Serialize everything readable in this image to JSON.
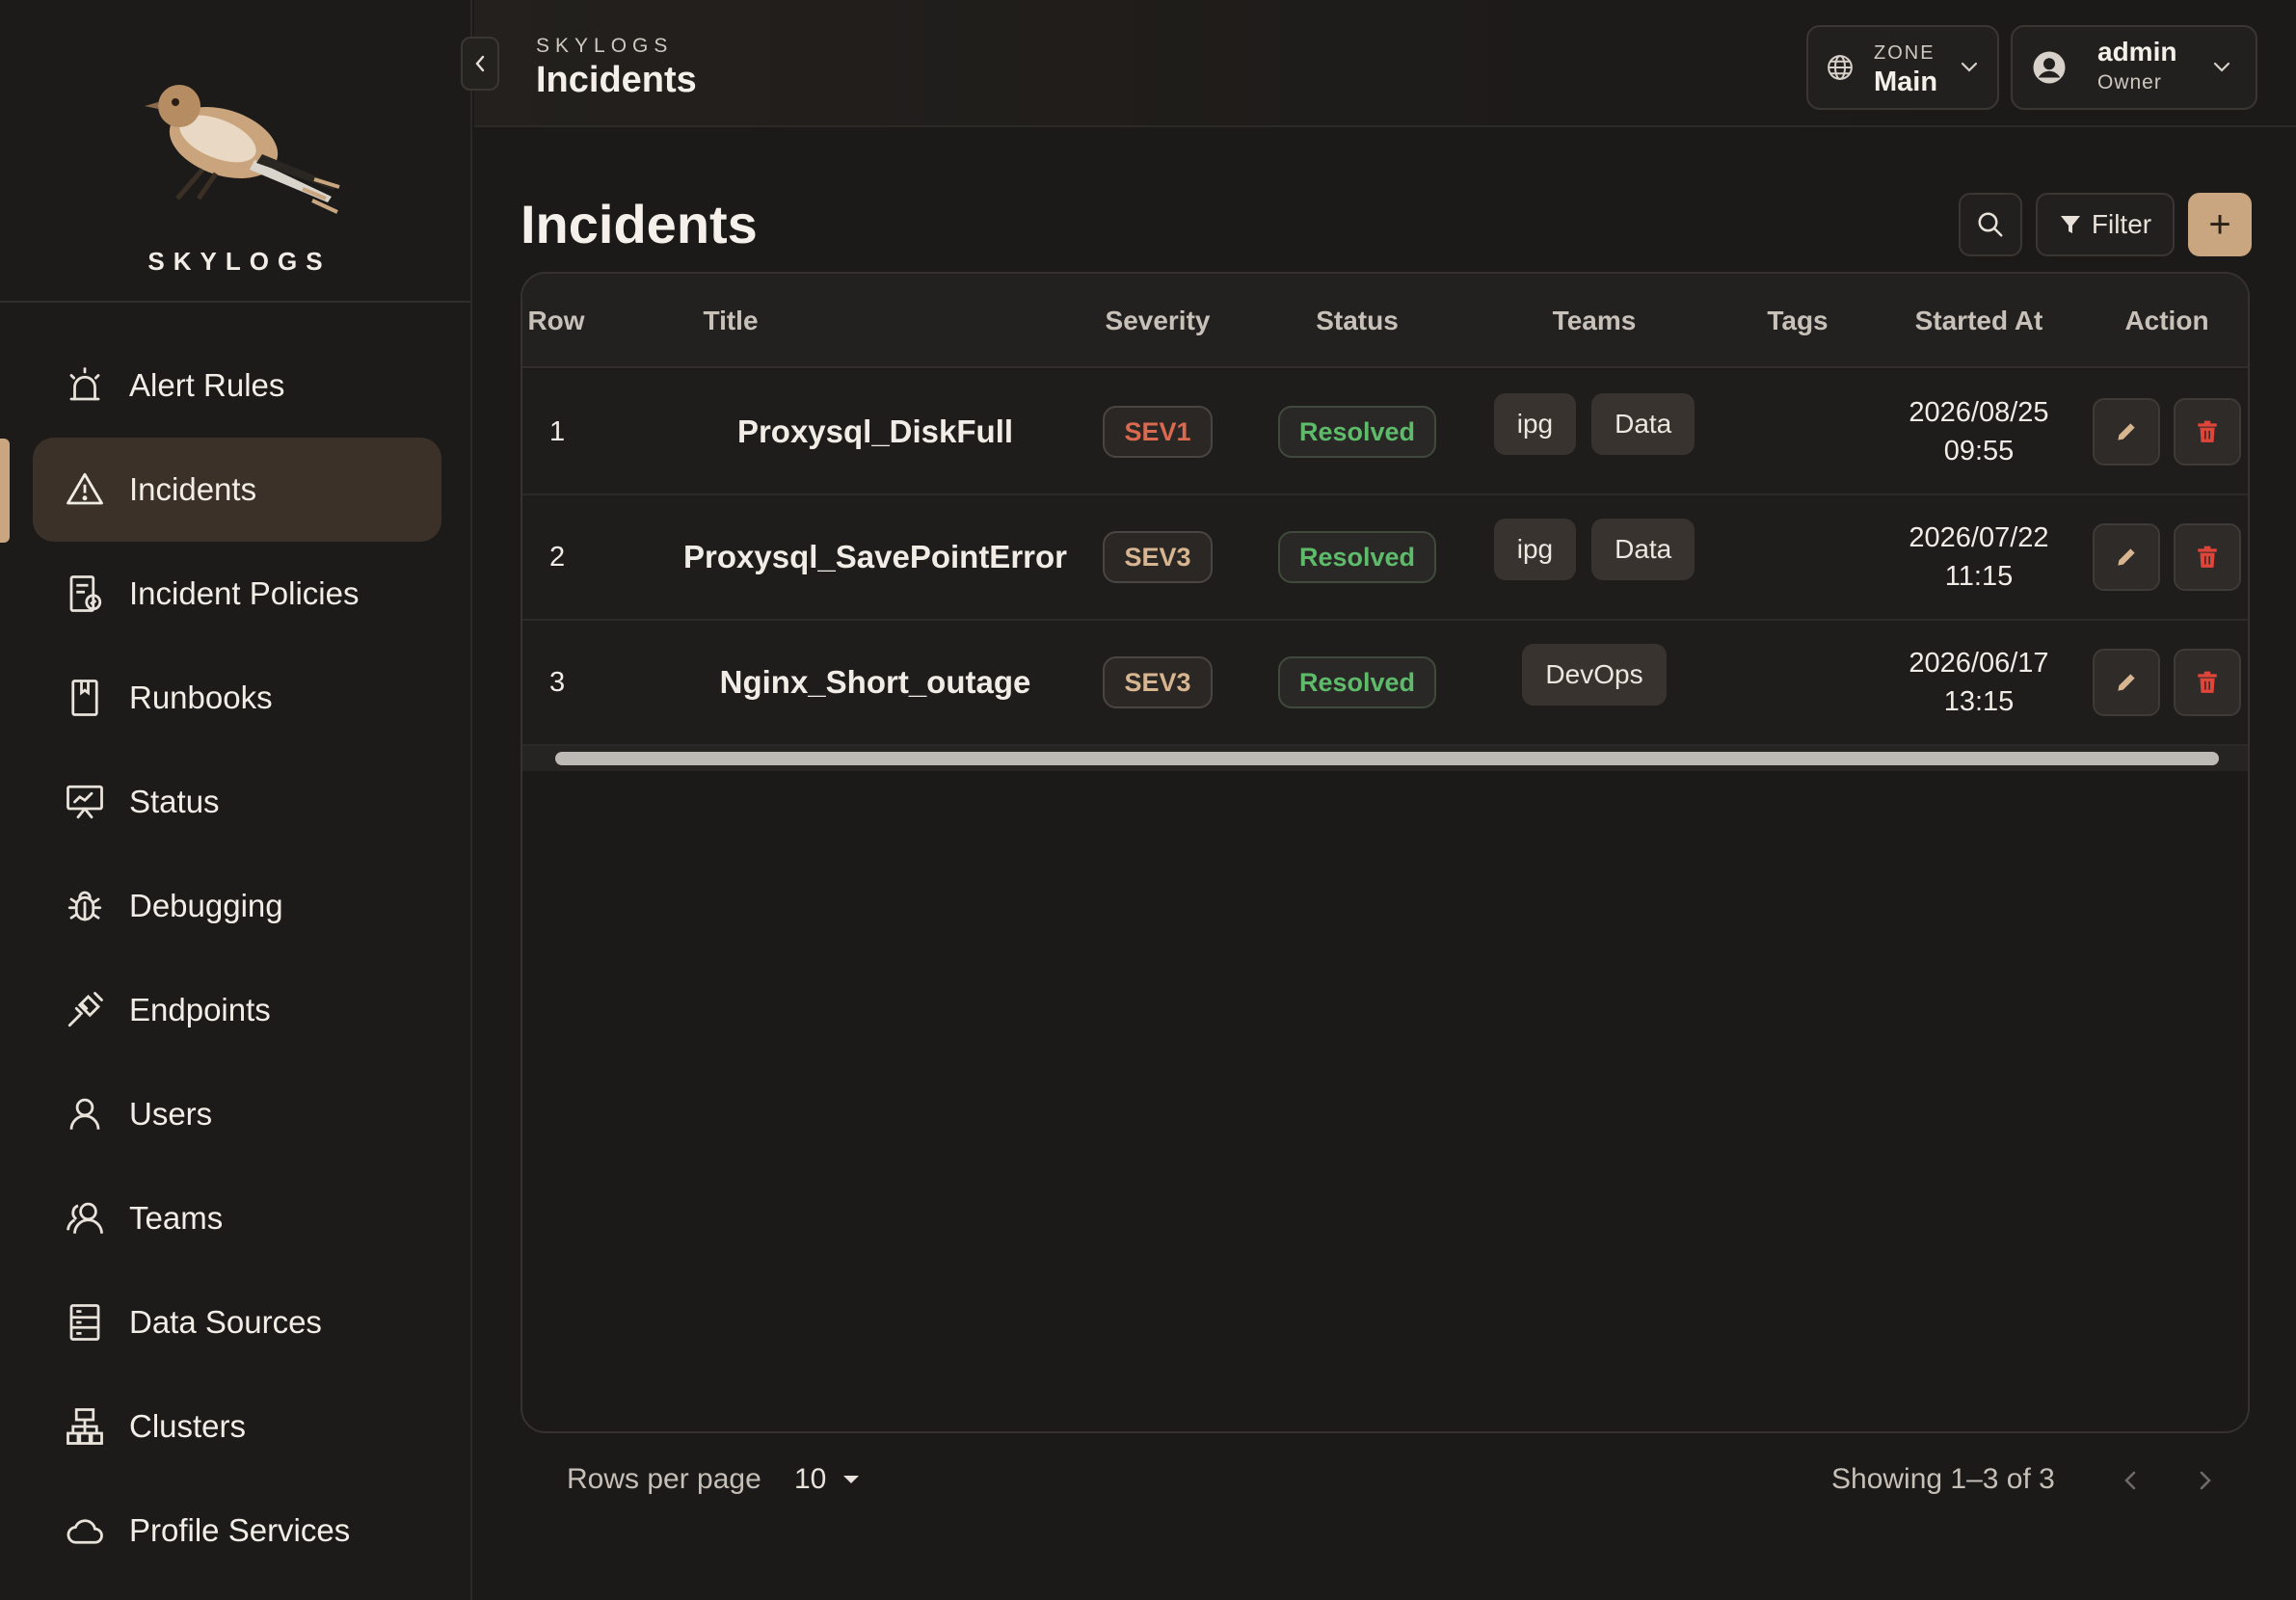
{
  "brand": {
    "name": "SKYLOGS"
  },
  "sidebar": {
    "items": [
      {
        "label": "Alert Rules",
        "icon": "alarm-icon"
      },
      {
        "label": "Incidents",
        "icon": "warning-triangle-icon",
        "active": true
      },
      {
        "label": "Incident Policies",
        "icon": "policy-document-icon"
      },
      {
        "label": "Runbooks",
        "icon": "book-icon"
      },
      {
        "label": "Status",
        "icon": "status-board-icon"
      },
      {
        "label": "Debugging",
        "icon": "bug-icon"
      },
      {
        "label": "Endpoints",
        "icon": "plug-icon"
      },
      {
        "label": "Users",
        "icon": "user-icon"
      },
      {
        "label": "Teams",
        "icon": "team-icon"
      },
      {
        "label": "Data Sources",
        "icon": "server-icon"
      },
      {
        "label": "Clusters",
        "icon": "cluster-icon"
      },
      {
        "label": "Profile Services",
        "icon": "cloud-icon"
      }
    ]
  },
  "header": {
    "breadcrumb": "SKYLOGS",
    "title": "Incidents",
    "zone": {
      "label": "ZONE",
      "value": "Main"
    },
    "user": {
      "name": "admin",
      "role": "Owner"
    }
  },
  "page": {
    "title": "Incidents",
    "filter_label": "Filter",
    "add_label": "+"
  },
  "table": {
    "columns": [
      "Row",
      "Title",
      "Severity",
      "Status",
      "Teams",
      "Tags",
      "Started At",
      "Action"
    ],
    "rows": [
      {
        "row": "1",
        "title": "Proxysql_DiskFull",
        "severity": "SEV1",
        "status": "Resolved",
        "teams": [
          "ipg",
          "Data"
        ],
        "date": "2026/08/25",
        "time": "09:55"
      },
      {
        "row": "2",
        "title": "Proxysql_SavePointError",
        "severity": "SEV3",
        "status": "Resolved",
        "teams": [
          "ipg",
          "Data"
        ],
        "date": "2026/07/22",
        "time": "11:15"
      },
      {
        "row": "3",
        "title": "Nginx_Short_outage",
        "severity": "SEV3",
        "status": "Resolved",
        "teams": [
          "DevOps"
        ],
        "date": "2026/06/17",
        "time": "13:15"
      }
    ]
  },
  "footer": {
    "rows_per_page_label": "Rows per page",
    "rows_per_page_value": "10",
    "showing": "Showing 1–3 of 3"
  },
  "colors": {
    "accent": "#c9a67f",
    "sev1": "#d9694f",
    "sev3": "#d8b591",
    "resolved": "#5dbb6a",
    "delete": "#e0453a"
  }
}
